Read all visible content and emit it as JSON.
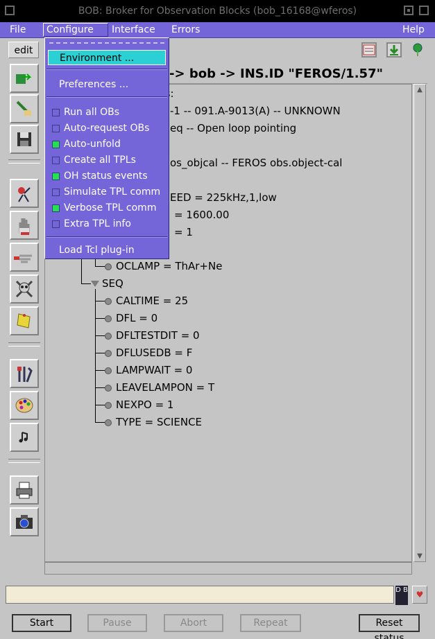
{
  "window": {
    "title": "BOB: Broker for Observation Blocks (bob_16168@wferos)"
  },
  "menubar": {
    "file": "File",
    "configure": "Configure",
    "interface": "Interface",
    "errors": "Errors",
    "help": "Help"
  },
  "toolbar": {
    "edit": "edit"
  },
  "breadcrumb": "-> bob -> INS.ID \"FEROS/1.57\"",
  "dropdown": {
    "environment": "Environment ...",
    "preferences": "Preferences ...",
    "options": [
      {
        "label": "Run all OBs",
        "checked": false
      },
      {
        "label": "Auto-request OBs",
        "checked": false
      },
      {
        "label": "Auto-unfold",
        "checked": true
      },
      {
        "label": "Create all TPLs",
        "checked": false
      },
      {
        "label": "OH status events",
        "checked": true
      },
      {
        "label": "Simulate TPL comm",
        "checked": false
      },
      {
        "label": "Verbose TPL comm",
        "checked": true
      },
      {
        "label": "Extra TPL info",
        "checked": false
      }
    ],
    "load_plugin": "Load Tcl plug-in"
  },
  "tree": {
    "partial": [
      "ks:",
      "-1 -- 091.A-9013(A) -- UNKNOWN",
      "eq -- Open loop pointing",
      "os_objcal -- FEROS obs.object-cal",
      "EED = 225kHz,1,low",
      "= 1600.00",
      "= 1"
    ],
    "oclamp": "OCLAMP = ThAr+Ne",
    "seq": "SEQ",
    "seq_items": [
      "CALTIME = 25",
      "DFL = 0",
      "DFLTESTDIT = 0",
      "DFLUSEDB = F",
      "LAMPWAIT = 0",
      "LEAVELAMPON = T",
      "NEXPO = 1",
      "TYPE = SCIENCE"
    ]
  },
  "statusbar": {
    "db": "D B",
    "heart": "♥"
  },
  "buttons": {
    "start": "Start",
    "pause": "Pause",
    "abort": "Abort",
    "repeat": "Repeat",
    "reset": "Reset status"
  }
}
